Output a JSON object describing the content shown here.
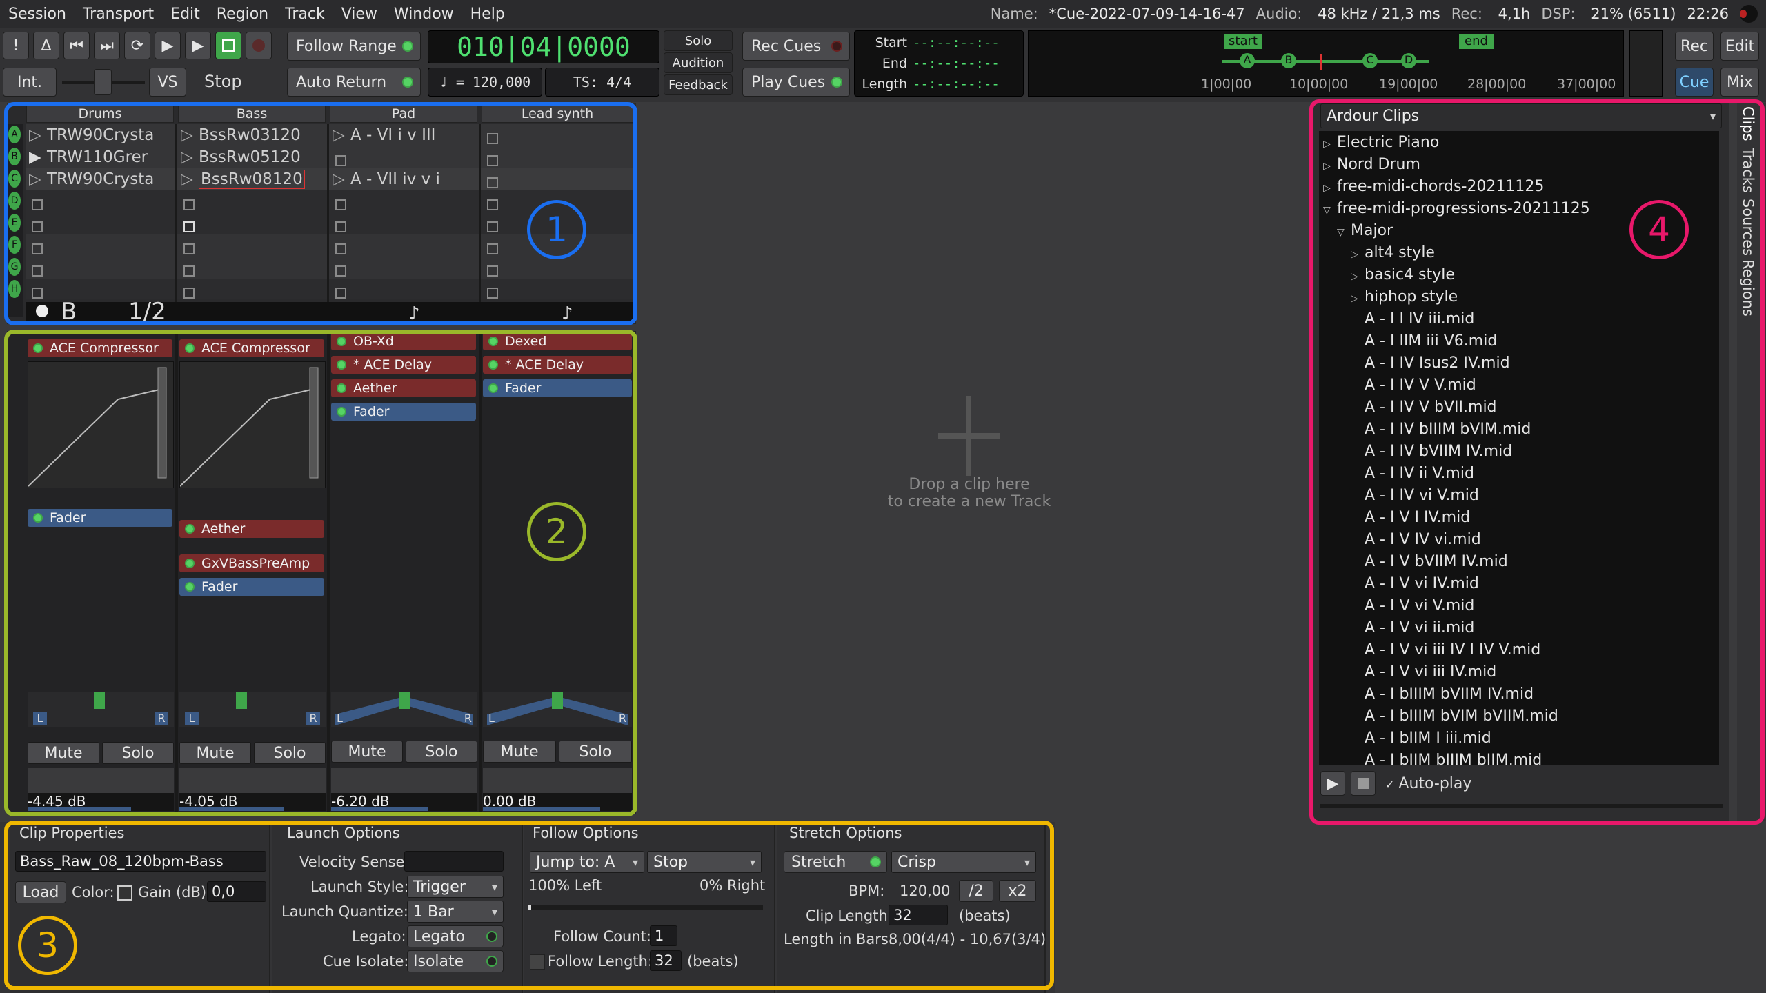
{
  "menu": [
    "Session",
    "Transport",
    "Edit",
    "Region",
    "Track",
    "View",
    "Window",
    "Help"
  ],
  "status": {
    "name_label": "Name:",
    "name": "*Cue-2022-07-09-14-16-47",
    "audio_label": "Audio:",
    "audio": "48 kHz / 21,3 ms",
    "rec_label": "Rec:",
    "rec": "4,1h",
    "dsp_label": "DSP:",
    "dsp": "21% (6511)",
    "time": "22:26"
  },
  "transport": {
    "int": "Int.",
    "vs": "VS",
    "stop": "Stop",
    "follow_range": "Follow Range",
    "auto_return": "Auto Return",
    "clock": "010|04|0000",
    "tempo": "♩ = 120,000",
    "ts": "TS: 4/4",
    "solo": "Solo",
    "audition": "Audition",
    "feedback": "Feedback",
    "rec_cues": "Rec Cues",
    "play_cues": "Play Cues",
    "start_label": "Start",
    "end_label": "End",
    "length_label": "Length",
    "start_val": "--:--:--:--",
    "end_val": "--:--:--:--",
    "length_val": "--:--:--:--",
    "rec": "Rec",
    "edit": "Edit",
    "cue": "Cue",
    "mix": "Mix"
  },
  "mini_timeline": {
    "start": "start",
    "end": "end",
    "markers": [
      "A",
      "B",
      "C",
      "D"
    ],
    "ticks": [
      "1|00|00",
      "10|00|00",
      "19|00|00",
      "28|00|00",
      "37|00|00"
    ]
  },
  "cue_letters": [
    "A",
    "B",
    "C",
    "D",
    "E",
    "F",
    "G",
    "H"
  ],
  "grid": {
    "tracks": [
      "Drums",
      "Bass",
      "Pad",
      "Lead synth"
    ],
    "drums": [
      "TRW90Crysta",
      "TRW110Grer",
      "TRW90Crysta"
    ],
    "bass": [
      "BssRw03120",
      "BssRw05120",
      "BssRw08120"
    ],
    "pad": [
      "A - VI i v III",
      "A - VII iv v i"
    ],
    "footer": [
      "B",
      "1/2"
    ]
  },
  "strips": {
    "drums": {
      "plugins": [
        "ACE Compressor",
        "Fader"
      ],
      "mute": "Mute",
      "solo": "Solo",
      "gain": "-4.45 dB"
    },
    "bass": {
      "plugins": [
        "ACE Compressor",
        "Aether",
        "GxVBassPreAmp",
        "Fader"
      ],
      "mute": "Mute",
      "solo": "Solo",
      "gain": "-4.05 dB"
    },
    "pad": {
      "plugins": [
        "OB-Xd",
        "* ACE Delay",
        "Aether",
        "Fader"
      ],
      "mute": "Mute",
      "solo": "Solo",
      "gain": "-6.20 dB"
    },
    "lead": {
      "plugins": [
        "Dexed",
        "* ACE Delay",
        "Fader"
      ],
      "mute": "Mute",
      "solo": "Solo",
      "gain": "0.00 dB"
    },
    "L": "L",
    "R": "R"
  },
  "drop_hint": {
    "line1": "Drop a clip here",
    "line2": "to create a new Track"
  },
  "clip_props": {
    "title": "Clip Properties",
    "name": "Bass_Raw_08_120bpm-Bass",
    "load": "Load",
    "color": "Color:",
    "gain_label": "Gain (dB):",
    "gain": "0,0"
  },
  "launch": {
    "title": "Launch Options",
    "velocity": "Velocity Sense:",
    "style_label": "Launch Style:",
    "style": "Trigger",
    "quant_label": "Launch Quantize:",
    "quant": "1 Bar",
    "legato_label": "Legato:",
    "legato": "Legato",
    "isolate_label": "Cue Isolate:",
    "isolate": "Isolate"
  },
  "follow": {
    "title": "Follow Options",
    "jump": "Jump to: A",
    "stop": "Stop",
    "left": "100% Left",
    "right": "0% Right",
    "count_label": "Follow Count:",
    "count": "1",
    "length_label": "Follow Length:",
    "length": "32",
    "beats": "(beats)"
  },
  "stretch": {
    "title": "Stretch Options",
    "stretch": "Stretch",
    "mode": "Crisp",
    "bpm_label": "BPM:",
    "bpm": "120,00",
    "half": "/2",
    "double": "x2",
    "clip_len_label": "Clip Length:",
    "clip_len": "32",
    "beats": "(beats)",
    "bars_label": "Length in Bars:",
    "bars": "8,00(4/4) - 10,67(3/4)"
  },
  "browser": {
    "source": "Ardour Clips",
    "items": [
      {
        "t": "Electric Piano",
        "lvl": 0,
        "exp": "closed"
      },
      {
        "t": "Nord Drum",
        "lvl": 0,
        "exp": "closed"
      },
      {
        "t": "free-midi-chords-20211125",
        "lvl": 0,
        "exp": "closed"
      },
      {
        "t": "free-midi-progressions-20211125",
        "lvl": 0,
        "exp": "open"
      },
      {
        "t": "Major",
        "lvl": 1,
        "exp": "open"
      },
      {
        "t": "alt4 style",
        "lvl": 2,
        "exp": "closed"
      },
      {
        "t": "basic4 style",
        "lvl": 2,
        "exp": "closed"
      },
      {
        "t": "hiphop style",
        "lvl": 2,
        "exp": "closed"
      },
      {
        "t": "A - I I IV iii.mid",
        "lvl": 2,
        "exp": ""
      },
      {
        "t": "A - I IIM iii V6.mid",
        "lvl": 2,
        "exp": ""
      },
      {
        "t": "A - I IV Isus2 IV.mid",
        "lvl": 2,
        "exp": ""
      },
      {
        "t": "A - I IV V V.mid",
        "lvl": 2,
        "exp": ""
      },
      {
        "t": "A - I IV V bVII.mid",
        "lvl": 2,
        "exp": ""
      },
      {
        "t": "A - I IV bIIIM bVIM.mid",
        "lvl": 2,
        "exp": ""
      },
      {
        "t": "A - I IV bVIIM IV.mid",
        "lvl": 2,
        "exp": ""
      },
      {
        "t": "A - I IV ii V.mid",
        "lvl": 2,
        "exp": ""
      },
      {
        "t": "A - I IV vi V.mid",
        "lvl": 2,
        "exp": ""
      },
      {
        "t": "A - I V I IV.mid",
        "lvl": 2,
        "exp": ""
      },
      {
        "t": "A - I V IV vi.mid",
        "lvl": 2,
        "exp": ""
      },
      {
        "t": "A - I V bVIIM IV.mid",
        "lvl": 2,
        "exp": ""
      },
      {
        "t": "A - I V vi IV.mid",
        "lvl": 2,
        "exp": ""
      },
      {
        "t": "A - I V vi V.mid",
        "lvl": 2,
        "exp": ""
      },
      {
        "t": "A - I V vi ii.mid",
        "lvl": 2,
        "exp": ""
      },
      {
        "t": "A - I V vi iii IV I IV V.mid",
        "lvl": 2,
        "exp": ""
      },
      {
        "t": "A - I V vi iii IV.mid",
        "lvl": 2,
        "exp": ""
      },
      {
        "t": "A - I bIIIM bVIIM IV.mid",
        "lvl": 2,
        "exp": ""
      },
      {
        "t": "A - I bIIIM bVIM bVIIM.mid",
        "lvl": 2,
        "exp": ""
      },
      {
        "t": "A - I bIIM I iii.mid",
        "lvl": 2,
        "exp": ""
      },
      {
        "t": "A - I bIIM bIIIM bIIM.mid",
        "lvl": 2,
        "exp": ""
      }
    ],
    "autoplay": "Auto-play"
  },
  "side_tabs": [
    "Clips",
    "Tracks",
    "Sources",
    "Regions"
  ],
  "callouts": [
    "1",
    "2",
    "3",
    "4"
  ]
}
